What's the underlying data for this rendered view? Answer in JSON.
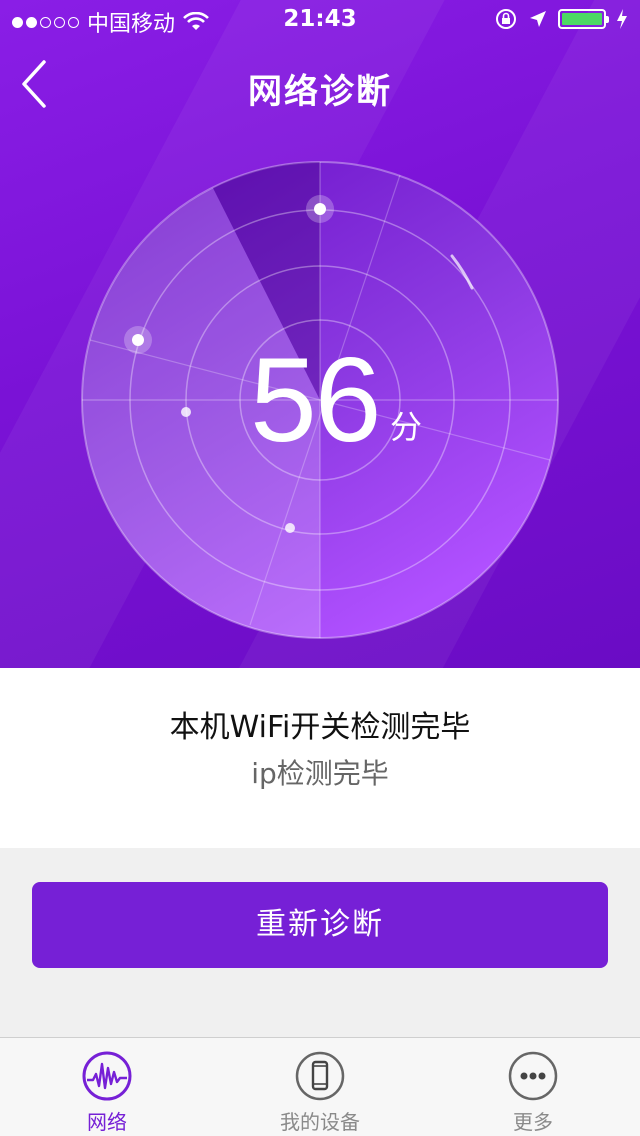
{
  "status_bar": {
    "carrier": "中国移动",
    "time": "21:43"
  },
  "nav": {
    "title": "网络诊断"
  },
  "score": {
    "value": "56",
    "unit": "分"
  },
  "progress": {
    "line1": "本机WiFi开关检测完毕",
    "line2": "ip检测完毕"
  },
  "action": {
    "rediagnose_label": "重新诊断"
  },
  "tabs": [
    {
      "label": "网络",
      "icon": "network-wave-icon",
      "active": true
    },
    {
      "label": "我的设备",
      "icon": "phone-device-icon",
      "active": false
    },
    {
      "label": "更多",
      "icon": "more-dots-icon",
      "active": false
    }
  ],
  "colors": {
    "primary": "#7620d6",
    "hero": "#7a12d6",
    "battery": "#4cd964"
  }
}
